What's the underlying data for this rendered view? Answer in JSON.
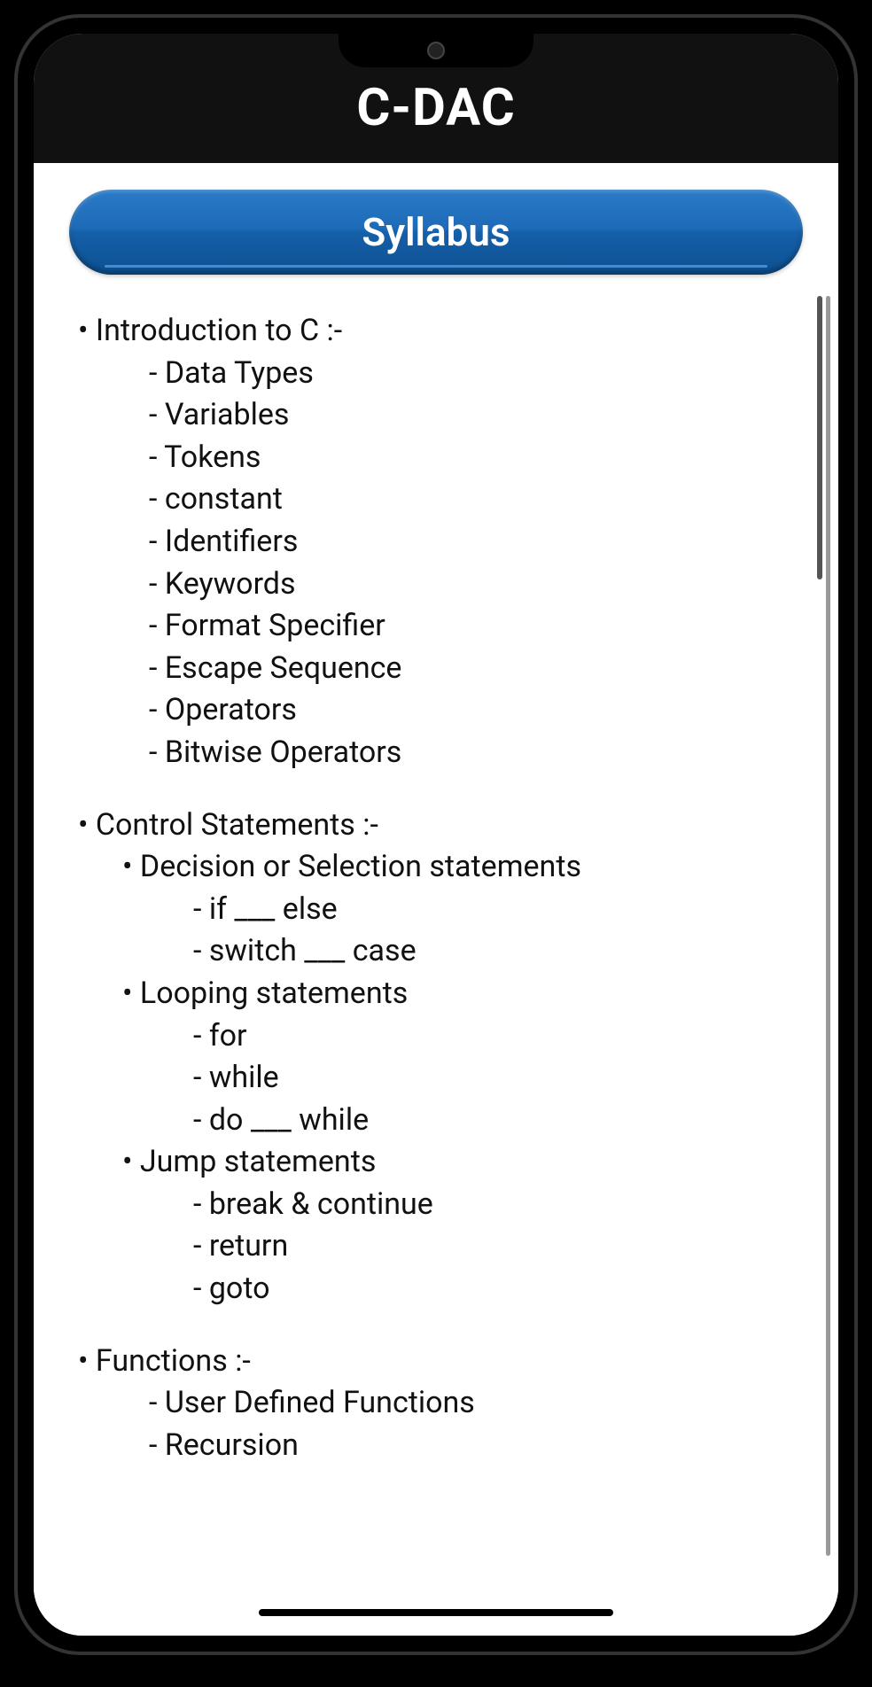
{
  "header": {
    "title": "C-DAC"
  },
  "syllabus": {
    "button_label": "Syllabus",
    "sections": [
      {
        "title": "• Introduction to C :-",
        "items": [
          "- Data Types",
          "- Variables",
          "- Tokens",
          "- constant",
          "- Identifiers",
          "- Keywords",
          "- Format Specifier",
          "- Escape Sequence",
          "- Operators",
          "- Bitwise Operators"
        ]
      },
      {
        "title": "• Control Statements :-",
        "subsections": [
          {
            "title": "• Decision or Selection statements",
            "items": [
              "- if ___ else",
              "- switch ___ case"
            ]
          },
          {
            "title": "• Looping statements",
            "items": [
              "- for",
              "- while",
              "- do ___ while"
            ]
          },
          {
            "title": "• Jump statements",
            "items": [
              "- break & continue",
              "- return",
              "- goto"
            ]
          }
        ]
      },
      {
        "title": "• Functions :-",
        "items": [
          "- User Defined Functions",
          "- Recursion"
        ]
      }
    ]
  }
}
